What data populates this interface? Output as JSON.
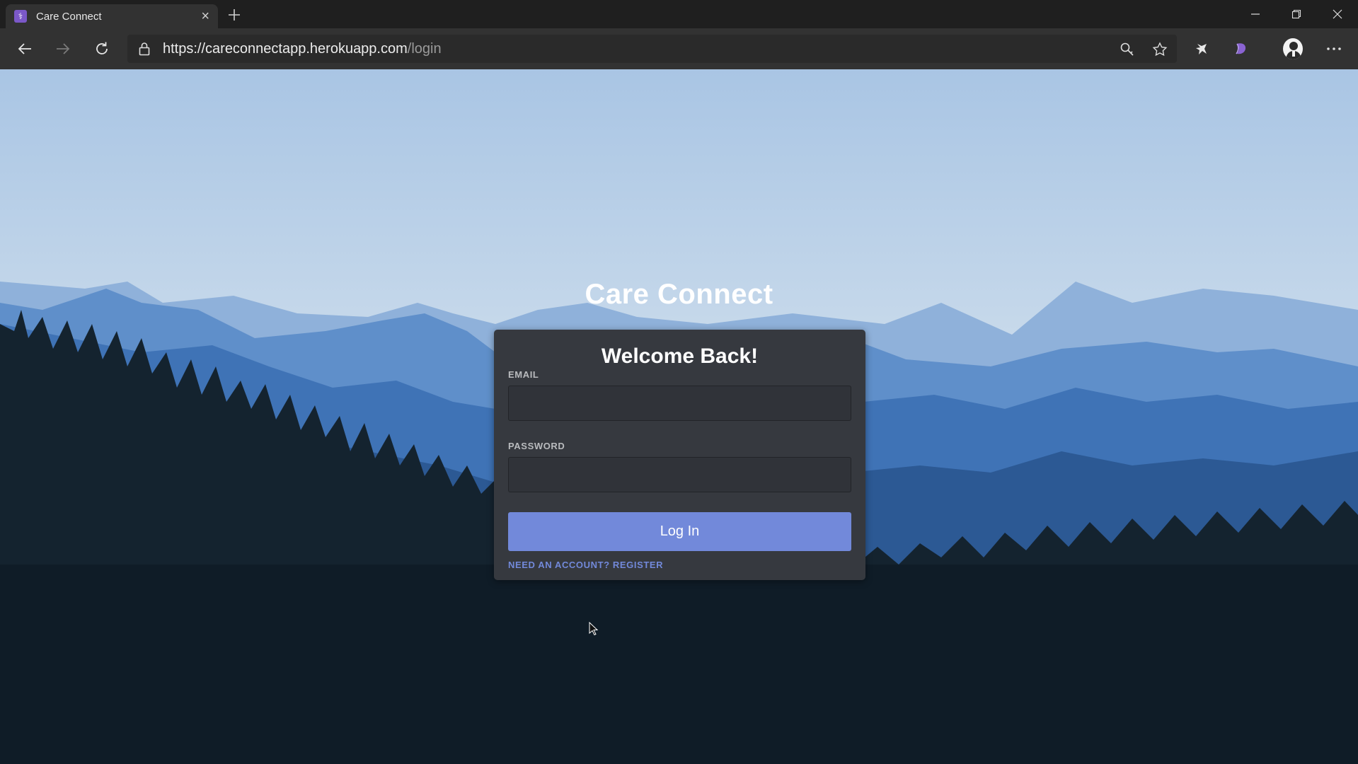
{
  "browser": {
    "tab": {
      "title": "Care Connect",
      "favicon_glyph": "⚕"
    },
    "new_tab_icon": "plus-icon",
    "window_controls": [
      "minimize-icon",
      "restore-icon",
      "close-icon"
    ],
    "address": {
      "url_main": "https://careconnectapp.herokuapp.com",
      "url_path": "/login"
    }
  },
  "page": {
    "brand": "Care Connect",
    "card": {
      "title": "Welcome Back!",
      "email_label": "EMAIL",
      "email_value": "",
      "password_label": "PASSWORD",
      "password_value": "",
      "login_label": "Log In",
      "register_text": "NEED AN ACCOUNT? REGISTER"
    }
  },
  "colors": {
    "accent": "#7289da",
    "card_bg": "#36393f",
    "input_bg": "#303339",
    "label": "#b9bbbe",
    "favicon": "#7b58c8"
  }
}
